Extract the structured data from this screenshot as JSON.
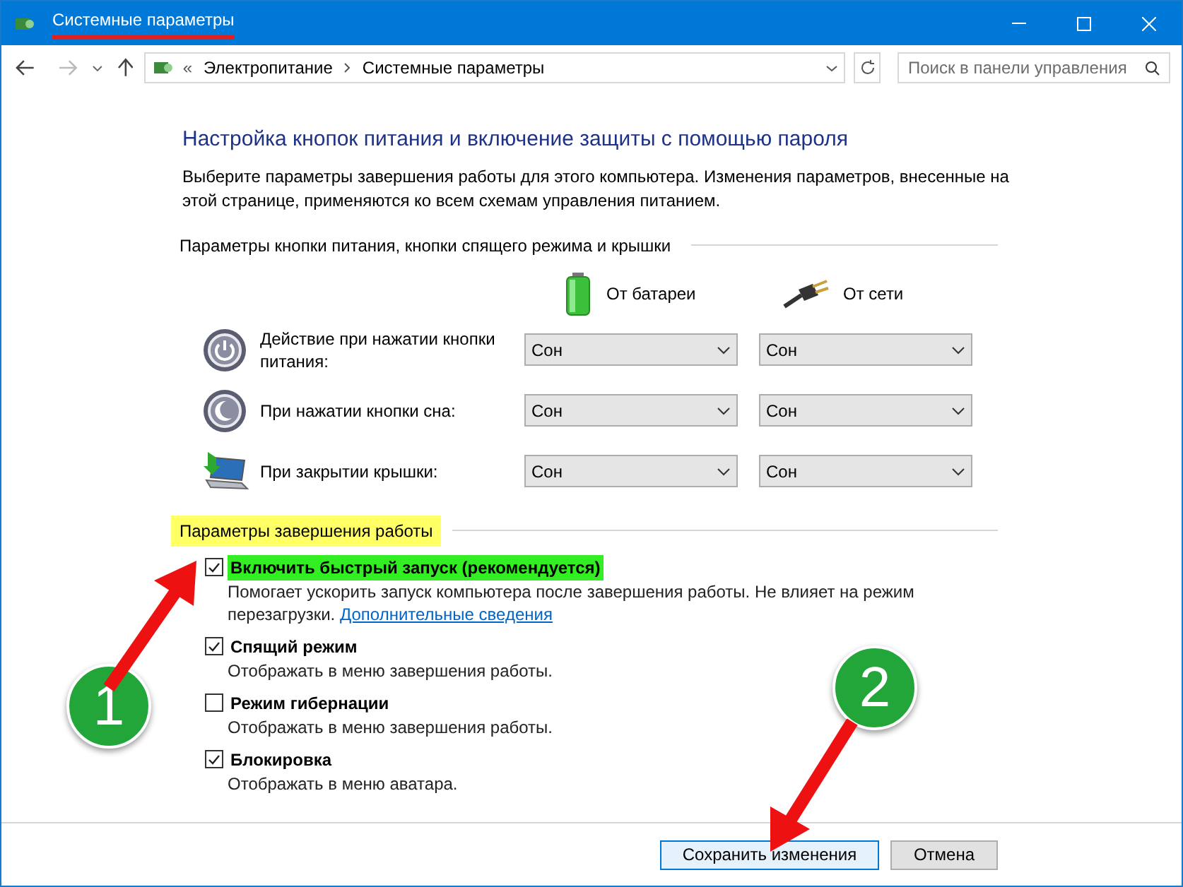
{
  "window": {
    "title": "Системные параметры",
    "title_underlined": true
  },
  "nav": {
    "breadcrumb_prefix": "«",
    "breadcrumbs": [
      "Электропитание",
      "Системные параметры"
    ],
    "search": {
      "placeholder": "Поиск в панели управления"
    }
  },
  "heading": "Настройка кнопок питания и включение защиты с помощью пароля",
  "description": "Выберите параметры завершения работы для этого компьютера. Изменения параметров, внесенные на этой странице, применяются ко всем схемам управления питанием.",
  "power_section": {
    "title": "Параметры кнопки питания, кнопки спящего режима и крышки",
    "highlighted": false,
    "columns": [
      {
        "label": "От батареи",
        "kind": "battery"
      },
      {
        "label": "От сети",
        "kind": "plug"
      }
    ],
    "rows": [
      {
        "kind": "power",
        "label": "Действие при нажатии кнопки питания:",
        "values": [
          "Сон",
          "Сон"
        ]
      },
      {
        "kind": "sleep",
        "label": "При нажатии кнопки сна:",
        "values": [
          "Сон",
          "Сон"
        ]
      },
      {
        "kind": "lid",
        "label": "При закрытии крышки:",
        "values": [
          "Сон",
          "Сон"
        ]
      }
    ]
  },
  "shutdown_section": {
    "title": "Параметры завершения работы",
    "highlighted": true,
    "options": [
      {
        "label": "Включить быстрый запуск (рекомендуется)",
        "checked": true,
        "highlighted": true,
        "description": "Помогает ускорить запуск компьютера после завершения работы. Не влияет на режим перезагрузки.",
        "link": "Дополнительные сведения"
      },
      {
        "label": "Спящий режим",
        "checked": true,
        "highlighted": false,
        "description": "Отображать в меню завершения работы."
      },
      {
        "label": "Режим гибернации",
        "checked": false,
        "highlighted": false,
        "description": "Отображать в меню завершения работы."
      },
      {
        "label": "Блокировка",
        "checked": true,
        "highlighted": false,
        "description": "Отображать в меню аватара."
      }
    ]
  },
  "buttons": [
    {
      "label": "Сохранить изменения",
      "kind": "primary"
    },
    {
      "label": "Отмена",
      "kind": "secondary"
    }
  ],
  "annotations": [
    {
      "label": "1"
    },
    {
      "label": "2"
    }
  ]
}
